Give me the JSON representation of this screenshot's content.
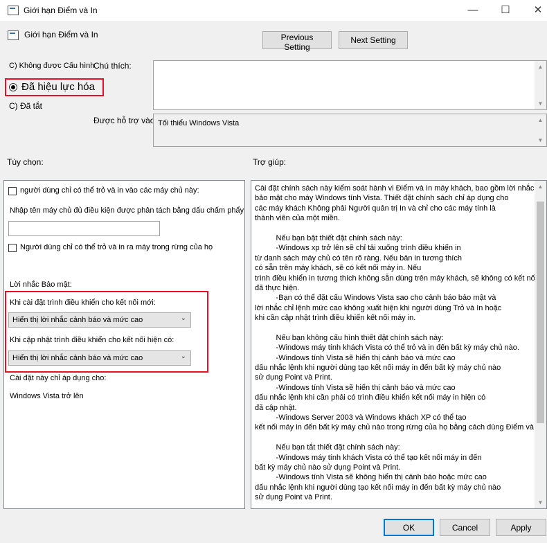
{
  "window": {
    "title": "Giới hạn Điểm và In",
    "minimize": "—",
    "maximize": "☐",
    "close": "✕"
  },
  "header": {
    "title": "Giới hạn Điểm và In"
  },
  "nav": {
    "previous": "Previous Setting",
    "next": "Next Setting"
  },
  "state": {
    "not_configured": "C) Không được Cấu hình",
    "enabled": "Đã hiệu lực hóa",
    "disabled": "C) Đã tắt",
    "selected": "enabled"
  },
  "comment": {
    "label": "Chú thích:",
    "value": ""
  },
  "supported": {
    "label": "Được hỗ trợ vào:",
    "value": "Tối thiểu Windows Vista"
  },
  "options": {
    "label": "Tùy chọn:",
    "check1": "người dùng chỉ có thể trỏ và in vào các máy chủ này:",
    "servers_label": "Nhập tên máy chủ đủ điều kiện được phân tách bằng dấu chấm phẩy",
    "servers_value": "",
    "check2": "Người dùng chỉ có thể trỏ và in ra máy trong rừng của họ",
    "security_label": "Lời nhắc Bảo mật:",
    "new_label": "Khi cài đặt trình điều khiển cho kết nối mới:",
    "new_value": "Hiển thị lời nhắc cảnh báo và mức cao",
    "update_label": "Khi cập nhật trình điều khiển cho kết nối hiện có:",
    "update_value": "Hiển thị lời nhắc cảnh báo và mức cao",
    "applies_label": "Cài đặt này chỉ áp dụng cho:",
    "applies_value": "Windows Vista trở lên"
  },
  "help": {
    "label": "Trợ giúp:",
    "lines": [
      "Cài đặt chính sách này kiểm soát hành vi Điểm và In máy khách, bao gồm lời nhắc",
      "bảo mật cho máy Windows tính Vista. Thiết đặt chính sách chỉ áp dụng cho",
      "các máy khách Không phải Người quản trị In và chỉ cho các máy tính là",
      "thành viên của một miền.",
      "",
      "          Nếu bạn bật thiết đặt chính sách này:",
      "          -Windows xp trở lên sẽ chỉ tải xuống trình điều khiển in",
      "từ danh sách máy chủ có tên rõ ràng. Nếu bản in tương thích",
      "có sẵn trên máy khách, sẽ có kết nối máy in. Nếu",
      "trình điều khiển in tương thích không sẵn dùng trên máy khách, sẽ không có kết nối",
      "đã thực hiện.",
      "          -Bạn có thể đặt cấu Windows Vista sao cho cảnh báo bảo mật và",
      "lời nhắc chỉ lệnh mức cao không xuất hiện khi người dùng Trỏ và In hoặc",
      "khi cần cập nhật trình điều khiển kết nối máy in.",
      "",
      "          Nếu bạn không cấu hình thiết đặt chính sách này:",
      "          -Windows máy tính khách Vista có thể trỏ và in đến bất kỳ máy chủ nào.",
      "          -Windows tính Vista sẽ hiển thị cảnh báo và mức cao",
      "dấu nhắc lệnh khi người dùng tạo kết nối máy in đến bất kỳ máy chủ nào",
      "sử dụng Point và Print.",
      "          -Windows tính Vista sẽ hiển thị cảnh báo và mức cao",
      "dấu nhắc lệnh khi cần phải có trình điều khiển kết nối máy in hiện có",
      "đã cập nhật.",
      "          -Windows Server 2003 và Windows khách XP có thể tạo",
      "kết nối máy in đến bất kỳ máy chủ nào trong rừng của họ bằng cách dùng Điểm và In.",
      "",
      "          Nếu bạn tắt thiết đặt chính sách này:",
      "          -Windows máy tính khách Vista có thể tạo kết nối máy in đến",
      "bất kỳ máy chủ nào sử dụng Point và Print.",
      "          -Windows tính Vista sẽ không hiển thị cảnh báo hoặc mức cao",
      "dấu nhắc lệnh khi người dùng tạo kết nối máy in đến bất kỳ máy chủ nào",
      "sử dụng Point và Print."
    ]
  },
  "footer": {
    "ok": "OK",
    "cancel": "Cancel",
    "apply": "Apply"
  },
  "colors": {
    "highlight_box": "#e81123",
    "accent": "#0078d7"
  }
}
